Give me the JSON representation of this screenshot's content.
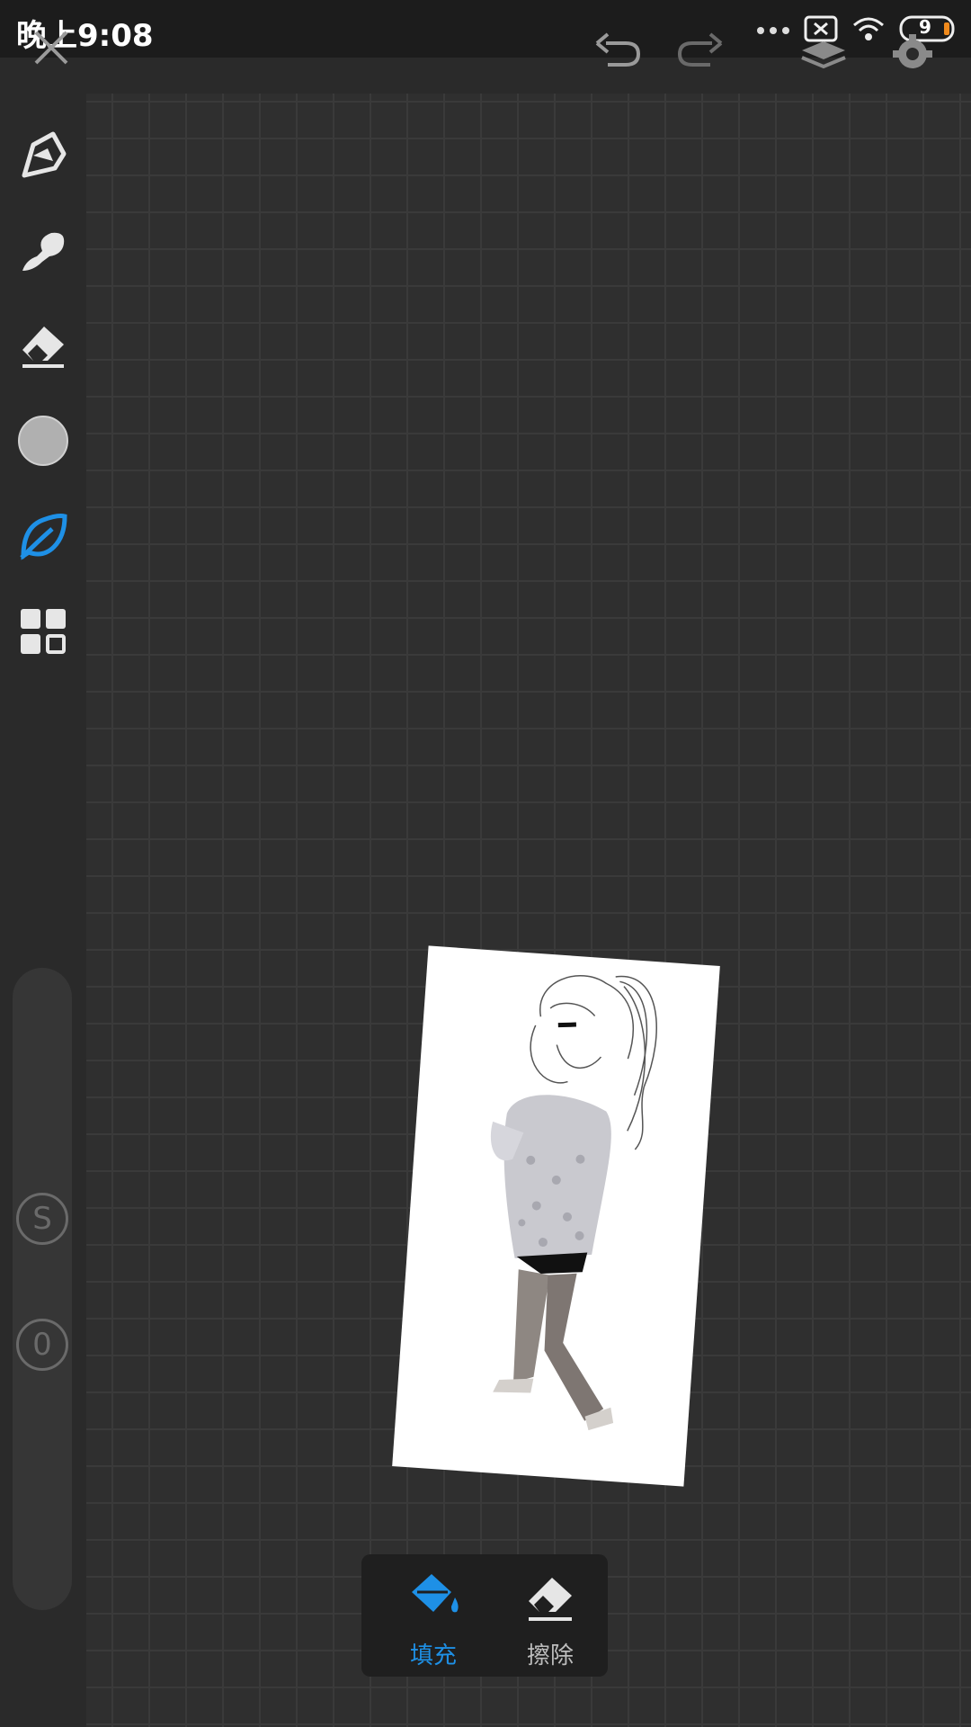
{
  "status_bar": {
    "time": "晚上9:08",
    "battery_level": "9",
    "icons": [
      "dots-icon",
      "sim-off-icon",
      "wifi-icon",
      "battery-icon"
    ]
  },
  "toolbar": {
    "icons": [
      "close-icon",
      "undo-icon",
      "redo-icon",
      "layers-icon",
      "settings-icon"
    ]
  },
  "sidebar": {
    "tools": [
      "pen-icon",
      "smudge-icon",
      "eraser-icon",
      "color-swatch",
      "leaf-brush-icon",
      "gallery-grid-icon"
    ],
    "active_tool": "leaf-brush-icon",
    "color": "#b0b0b0",
    "size_knob": "S",
    "opacity_knob": "0"
  },
  "bottom_tools": {
    "fill_label": "填充",
    "erase_label": "擦除",
    "active": "fill"
  },
  "colors": {
    "accent": "#1e90e6",
    "background": "#2e2e2e",
    "grid": "#3a3a3a"
  }
}
